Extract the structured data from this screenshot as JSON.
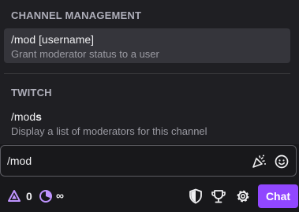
{
  "popup": {
    "sections": [
      {
        "title": "CHANNEL MANAGEMENT",
        "items": [
          {
            "command": "/mod",
            "args": " [username]",
            "description": "Grant moderator status to a user"
          }
        ]
      },
      {
        "title": "TWITCH",
        "items": [
          {
            "command_typed": "/mod",
            "command_rest": "s",
            "description": "Display a list of moderators for this channel"
          }
        ]
      }
    ]
  },
  "chat_input": {
    "value": "/mod"
  },
  "footer": {
    "channel_points": "0",
    "infinity": "∞",
    "chat_button_label": "Chat"
  },
  "colors": {
    "accent": "#9147ff",
    "points_icon": "#bf94ff"
  }
}
